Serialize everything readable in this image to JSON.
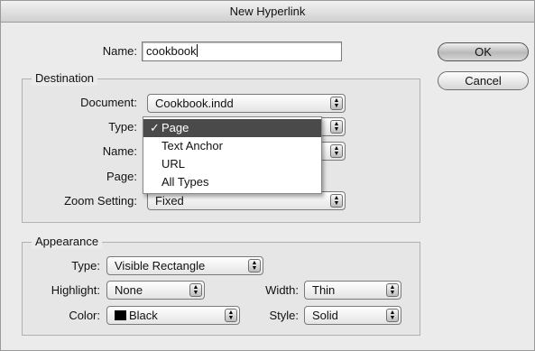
{
  "dialog": {
    "title": "New Hyperlink",
    "name_label": "Name:",
    "name_value": "cookbook",
    "ok_label": "OK",
    "cancel_label": "Cancel"
  },
  "destination": {
    "group_title": "Destination",
    "document_label": "Document:",
    "document_value": "Cookbook.indd",
    "type_label": "Type:",
    "type_menu": {
      "check": "✓",
      "items": [
        "Page",
        "Text Anchor",
        "URL",
        "All Types"
      ],
      "selected_index": 0
    },
    "name_label": "Name:",
    "page_label": "Page:",
    "zoom_label": "Zoom Setting:",
    "zoom_value": "Fixed"
  },
  "appearance": {
    "group_title": "Appearance",
    "type_label": "Type:",
    "type_value": "Visible Rectangle",
    "highlight_label": "Highlight:",
    "highlight_value": "None",
    "width_label": "Width:",
    "width_value": "Thin",
    "color_label": "Color:",
    "color_value": "Black",
    "color_swatch": "#000000",
    "style_label": "Style:",
    "style_value": "Solid"
  },
  "icons": {
    "select_arrows": "⬆⬇"
  }
}
